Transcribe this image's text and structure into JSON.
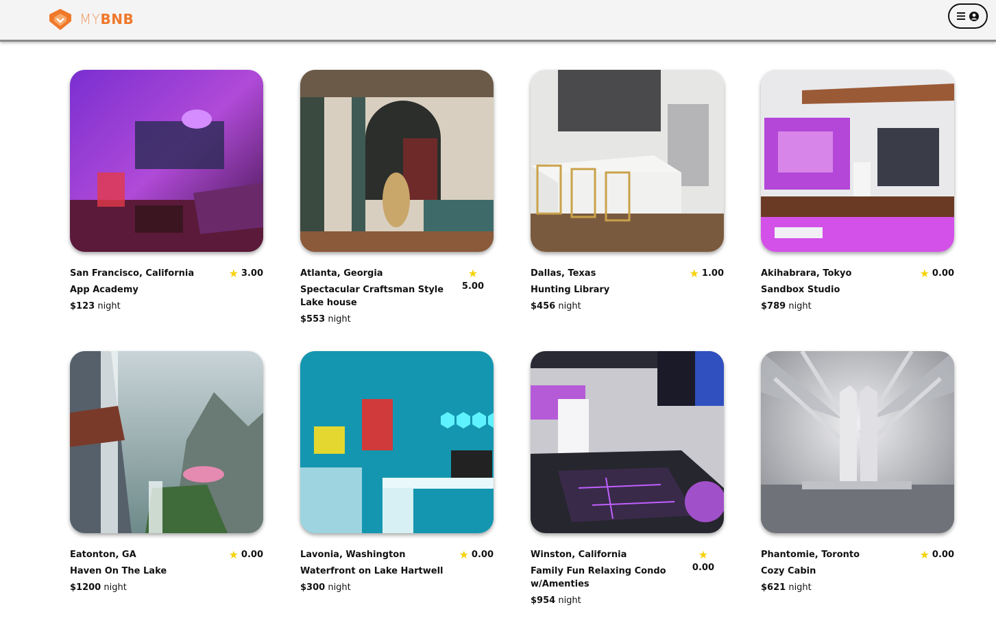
{
  "brand": {
    "prefix": "MY",
    "name": "BNB"
  },
  "header": {
    "menu_icon": "hamburger-icon",
    "user_icon": "user-circle-icon"
  },
  "price_unit": "night",
  "listings": [
    {
      "location": "San Francisco, California",
      "title": "App Academy",
      "price": "$123",
      "rating": "3.00"
    },
    {
      "location": "Atlanta, Georgia",
      "title": "Spectacular Craftsman Style Lake house",
      "price": "$553",
      "rating": "5.00"
    },
    {
      "location": "Dallas, Texas",
      "title": "Hunting Library",
      "price": "$456",
      "rating": "1.00"
    },
    {
      "location": "Akihabrara, Tokyo",
      "title": "Sandbox Studio",
      "price": "$789",
      "rating": "0.00"
    },
    {
      "location": "Eatonton, GA",
      "title": "Haven On The Lake",
      "price": "$1200",
      "rating": "0.00"
    },
    {
      "location": "Lavonia, Washington",
      "title": "Waterfront on Lake Hartwell",
      "price": "$300",
      "rating": "0.00"
    },
    {
      "location": "Winston, California",
      "title": "Family Fun Relaxing Condo w/Amenties",
      "price": "$954",
      "rating": "0.00"
    },
    {
      "location": "Phantomie, Toronto",
      "title": "Cozy Cabin",
      "price": "$621",
      "rating": "0.00"
    }
  ]
}
